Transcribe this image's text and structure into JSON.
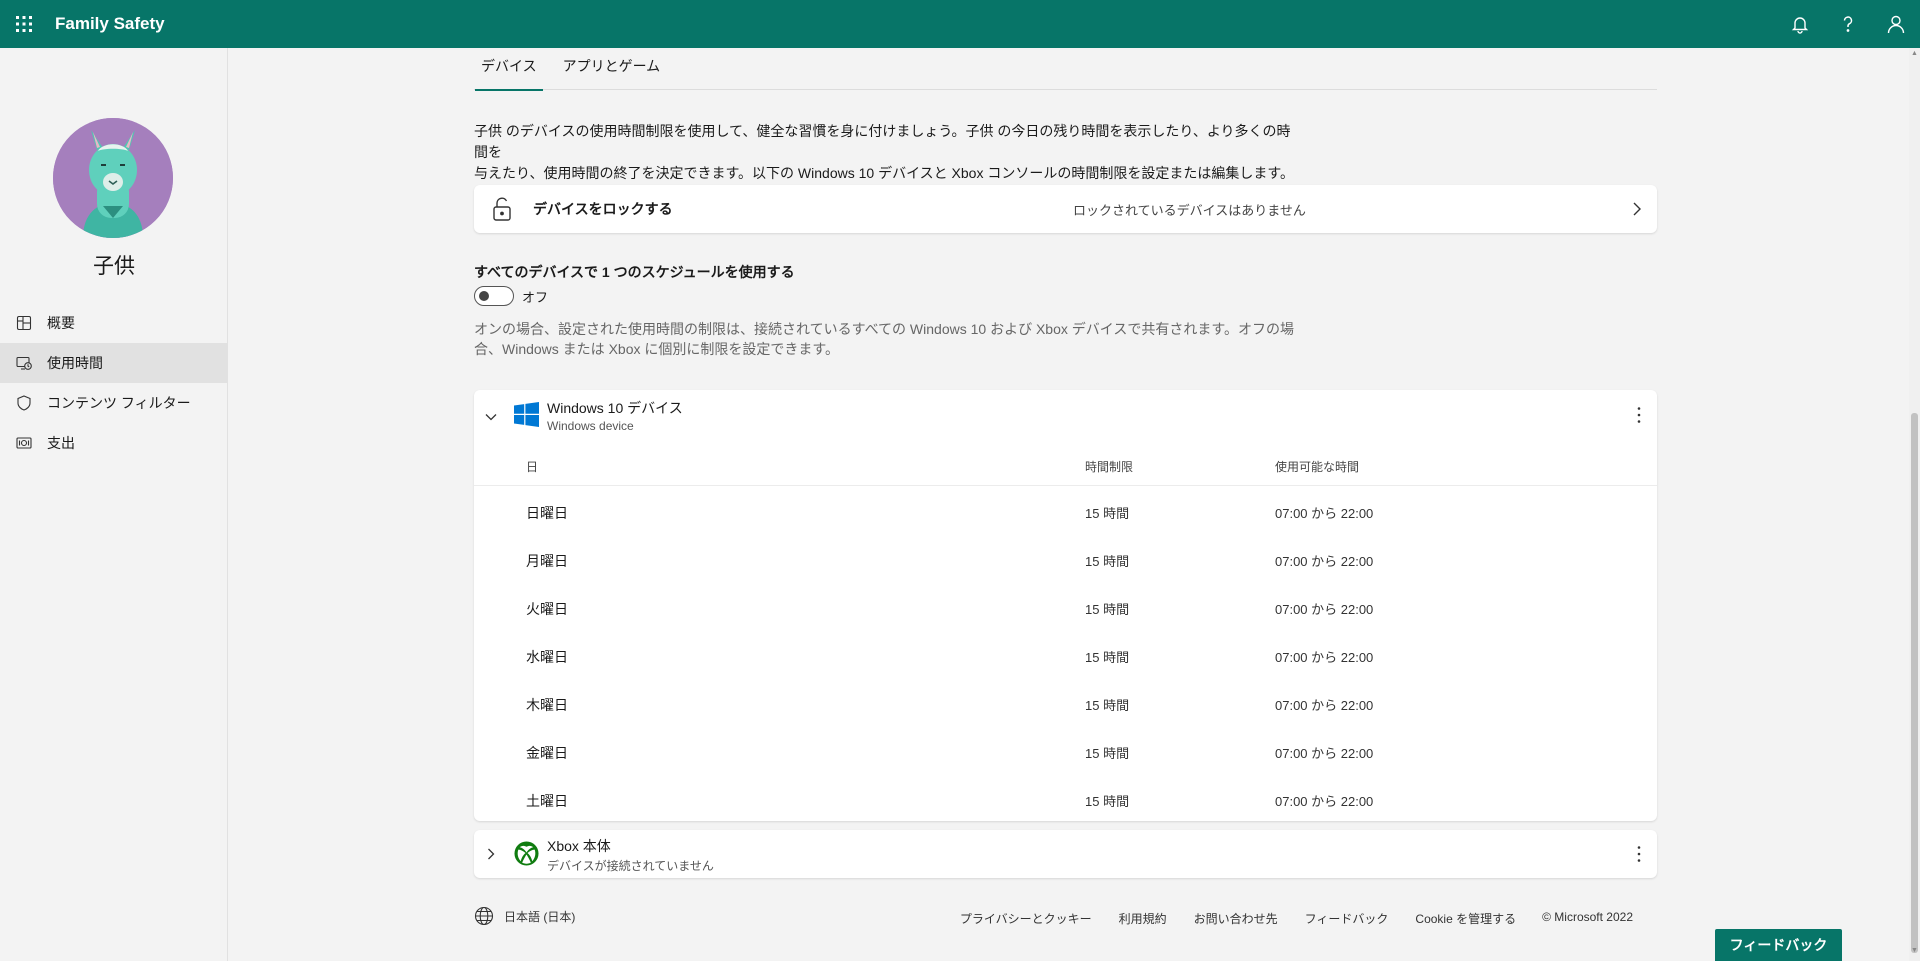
{
  "header": {
    "app_title": "Family Safety",
    "icons": [
      "waffle-icon",
      "bell-icon",
      "help-icon",
      "account-icon"
    ]
  },
  "sidebar": {
    "child_name": "子供",
    "items": [
      {
        "label": "概要",
        "icon": "overview-icon"
      },
      {
        "label": "使用時間",
        "icon": "screen-time-icon",
        "active": true
      },
      {
        "label": "コンテンツ フィルター",
        "icon": "shield-icon"
      },
      {
        "label": "支出",
        "icon": "spending-icon"
      }
    ]
  },
  "tabs": [
    {
      "label": "デバイス",
      "active": true
    },
    {
      "label": "アプリとゲーム",
      "active": false
    }
  ],
  "intro": {
    "line1": "子供 のデバイスの使用時間制限を使用して、健全な習慣を身に付けましょう。子供 の今日の残り時間を表示したり、より多くの時間を",
    "line2": "与えたり、使用時間の終了を決定できます。以下の Windows 10 デバイスと Xbox コンソールの時間制限を設定または編集します。"
  },
  "lock": {
    "title": "デバイスをロックする",
    "status": "ロックされているデバイスはありません"
  },
  "schedule": {
    "title": "すべてのデバイスで 1 つのスケジュールを使用する",
    "toggle_label": "オフ",
    "toggle_on": false,
    "desc_line1": "オンの場合、設定された使用時間の制限は、接続されているすべての Windows 10 および Xbox デバイスで共有されます。オフの場",
    "desc_line2": "合、Windows または Xbox に個別に制限を設定できます。"
  },
  "windows_device": {
    "title": "Windows 10 デバイス",
    "subtitle": "Windows device",
    "columns": {
      "day": "日",
      "limit": "時間制限",
      "range": "使用可能な時間"
    },
    "rows": [
      {
        "day": "日曜日",
        "limit": "15 時間",
        "range": "07:00 から 22:00"
      },
      {
        "day": "月曜日",
        "limit": "15 時間",
        "range": "07:00 から 22:00"
      },
      {
        "day": "火曜日",
        "limit": "15 時間",
        "range": "07:00 から 22:00"
      },
      {
        "day": "水曜日",
        "limit": "15 時間",
        "range": "07:00 から 22:00"
      },
      {
        "day": "木曜日",
        "limit": "15 時間",
        "range": "07:00 から 22:00"
      },
      {
        "day": "金曜日",
        "limit": "15 時間",
        "range": "07:00 から 22:00"
      },
      {
        "day": "土曜日",
        "limit": "15 時間",
        "range": "07:00 から 22:00"
      }
    ]
  },
  "xbox_device": {
    "title": "Xbox 本体",
    "subtitle": "デバイスが接続されていません"
  },
  "footer": {
    "language": "日本語 (日本)",
    "links": [
      "プライバシーとクッキー",
      "利用規約",
      "お問い合わせ先",
      "フィードバック",
      "Cookie を管理する"
    ],
    "copyright": "© Microsoft 2022"
  },
  "feedback_button": "フィードバック",
  "colors": {
    "brand": "#077568",
    "windows_blue": "#0078d4",
    "xbox_green": "#107c10",
    "avatar_bg": "#a57fbd"
  }
}
